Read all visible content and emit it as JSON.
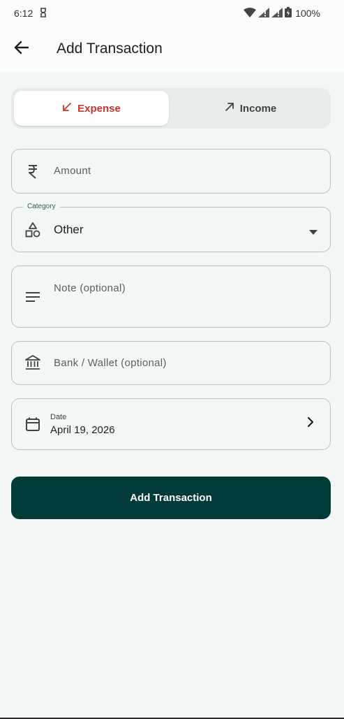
{
  "status_bar": {
    "time": "6:12",
    "battery": "100%"
  },
  "app_bar": {
    "title": "Add Transaction"
  },
  "type_toggle": {
    "expense_label": "Expense",
    "income_label": "Income",
    "selected": "Expense"
  },
  "form": {
    "amount": {
      "placeholder": "Amount",
      "icon": "rupee-icon"
    },
    "category": {
      "label": "Category",
      "value": "Other",
      "icon": "category-icon"
    },
    "note": {
      "placeholder": "Note (optional)",
      "icon": "notes-icon"
    },
    "bank": {
      "placeholder": "Bank / Wallet (optional)",
      "icon": "bank-icon"
    },
    "date": {
      "label": "Date",
      "value": "April 19, 2026",
      "icon": "calendar-icon"
    }
  },
  "submit": {
    "label": "Add Transaction"
  },
  "colors": {
    "accent": "#013b37",
    "expense": "#c6362c",
    "background": "#f3f7f5"
  }
}
